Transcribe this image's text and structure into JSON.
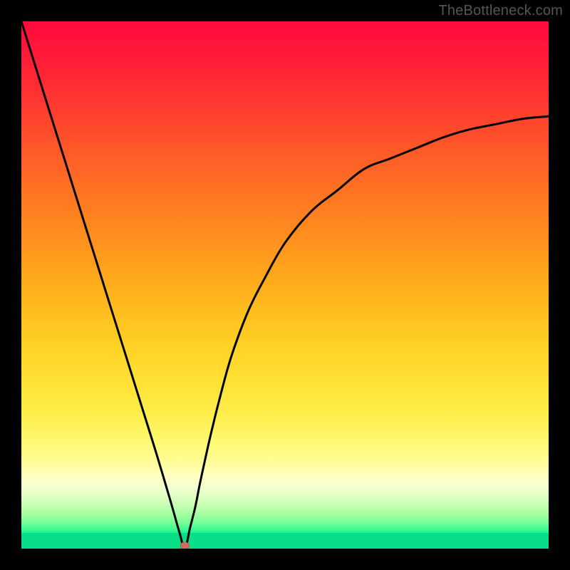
{
  "watermark": "TheBottleneck.com",
  "colors": {
    "frame_bg": "#000000",
    "curve_stroke": "#000000",
    "min_marker": "#d46a5f",
    "green_band": "#09dd87"
  },
  "chart_data": {
    "type": "line",
    "title": "",
    "xlabel": "",
    "ylabel": "",
    "xlim": [
      0,
      100
    ],
    "ylim": [
      0,
      100
    ],
    "description": "Single V-shaped bottleneck curve. Left branch is near-linear descending to the minimum at x≈31. Right branch rises steeply then asymptotically flattens toward y≈82 at x=100.",
    "series": [
      {
        "name": "bottleneck",
        "x": [
          0,
          5,
          10,
          15,
          20,
          25,
          28,
          30,
          31,
          32,
          33,
          34,
          36,
          38,
          40,
          43,
          46,
          50,
          55,
          60,
          65,
          70,
          75,
          80,
          85,
          90,
          95,
          100
        ],
        "values": [
          100,
          84,
          68,
          52,
          36,
          20,
          10,
          3,
          0,
          4,
          8,
          13,
          22,
          30,
          37,
          45,
          51,
          58,
          64,
          68,
          72,
          74,
          76,
          78,
          79.5,
          80.5,
          81.5,
          82
        ]
      }
    ],
    "minimum": {
      "x": 31,
      "y": 0
    },
    "annotations": []
  }
}
